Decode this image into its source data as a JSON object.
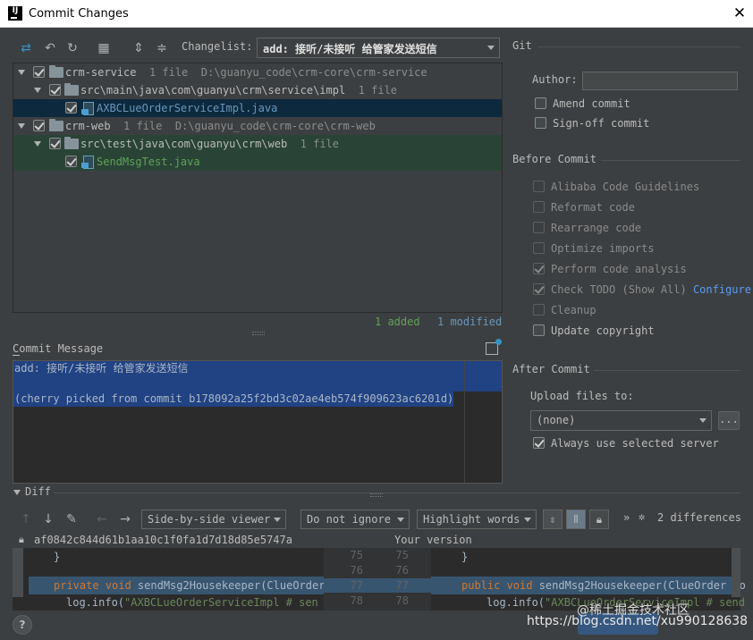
{
  "window": {
    "title": "Commit Changes",
    "close": "✕"
  },
  "toolbar": {
    "changelist_label": "Changelist:",
    "changelist_value": "add: 接听/未接听 给管家发送短信"
  },
  "tree": [
    {
      "name": "crm-service",
      "count": "1 file",
      "path": "D:\\guanyu_code\\crm-core\\crm-service"
    },
    {
      "name": "src\\main\\java\\com\\guanyu\\crm\\service\\impl",
      "count": "1 file"
    },
    {
      "name": "AXBCLueOrderServiceImpl.java"
    },
    {
      "name": "crm-web",
      "count": "1 file",
      "path": "D:\\guanyu_code\\crm-core\\crm-web"
    },
    {
      "name": "src\\test\\java\\com\\guanyu\\crm\\web",
      "count": "1 file"
    },
    {
      "name": "SendMsgTest.java"
    }
  ],
  "stats": {
    "added": "1 added",
    "modified": "1 modified"
  },
  "commit_message": {
    "label": "Commit Message",
    "line1": "add: 接听/未接听 给管家发送短信",
    "line2": "(cherry picked from commit b178092a25f2bd3c02ae4eb574f909623ac6201d)"
  },
  "git": {
    "section": "Git",
    "author_label": "Author:",
    "author_value": "",
    "amend": "Amend commit",
    "signoff": "Sign-off commit"
  },
  "before_commit": {
    "section": "Before Commit",
    "options": [
      {
        "label": "Alibaba Code Guidelines",
        "checked": false
      },
      {
        "label": "Reformat code",
        "checked": false
      },
      {
        "label": "Rearrange code",
        "checked": false
      },
      {
        "label": "Optimize imports",
        "checked": false
      },
      {
        "label": "Perform code analysis",
        "checked": true
      },
      {
        "label": "Check TODO (Show All)",
        "checked": true,
        "link": "Configure"
      },
      {
        "label": "Cleanup",
        "checked": false
      },
      {
        "label": "Update copyright",
        "checked": false
      }
    ]
  },
  "after_commit": {
    "section": "After Commit",
    "upload_label": "Upload files to:",
    "upload_value": "(none)",
    "more": "...",
    "always_use": "Always use selected server"
  },
  "diff": {
    "label": "Diff",
    "viewer": "Side-by-side viewer",
    "ignore": "Do not ignore",
    "highlight": "Highlight words",
    "more": "»",
    "count": "2 differences",
    "left_hash": "af0842c844d61b1aa10c1f0fa1d7d18d85e5747a",
    "right_title": "Your version",
    "line_numbers": [
      "75",
      "76",
      "77",
      "78"
    ],
    "left_lines": [
      "}",
      "",
      "private void sendMsg2Housekeeper(ClueOrder",
      "log.info(\"AXBCLueOrderServiceImpl # sen"
    ],
    "right_lines": [
      "}",
      "",
      "public void sendMsg2Housekeeper(ClueOrder co",
      "log.info(\"AXBCLueOrderServiceImpl # send"
    ]
  },
  "footer": {
    "help": "?",
    "watermark": "https://blog.csdn.net/xu990128638"
  },
  "watermark_overlay": "@稀土掘金技术社区"
}
